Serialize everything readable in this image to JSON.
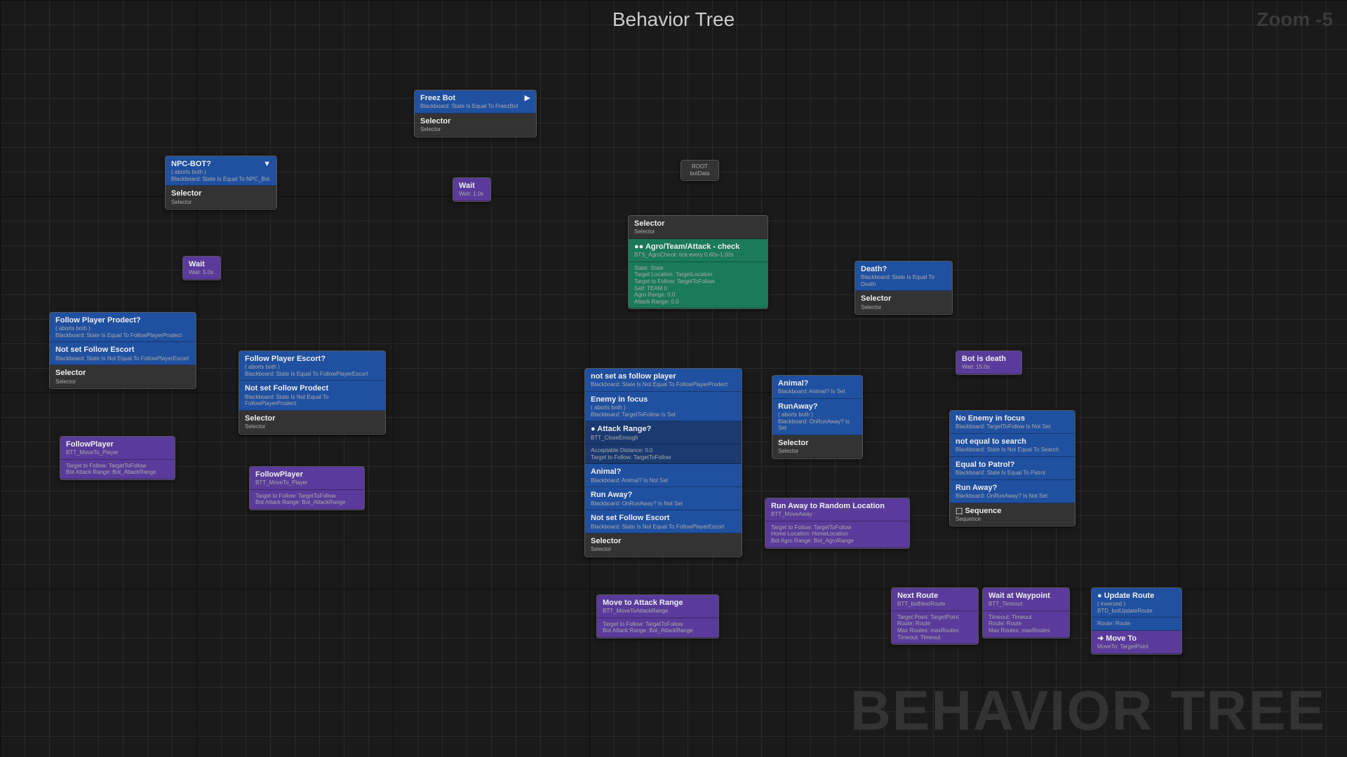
{
  "header": {
    "title": "Behavior Tree",
    "zoom": "Zoom -5",
    "watermark": "BEHAVIOR TREE"
  },
  "root": {
    "label": "ROOT",
    "sub": "botData"
  },
  "freez": {
    "title": "Freez Bot",
    "cond": "Blackboard: State Is Equal To FreezBot",
    "sel": "Selector",
    "selSub": "Selector"
  },
  "npc": {
    "title": "NPC-BOT?",
    "abort": "( aborts both )",
    "cond": "Blackboard: State Is Equal To NPC_Bot",
    "sel": "Selector",
    "selSub": "Selector"
  },
  "wait1": {
    "title": "Wait",
    "sub": "Wait: 1.0s"
  },
  "wait2": {
    "title": "Wait",
    "sub": "Wait: 5.0s"
  },
  "followProdect": {
    "title": "Follow Player Prodect?",
    "abort": "( aborts both )",
    "cond1": "Blackboard: State Is Equal To FollowPlayerProdect",
    "title2": "Not set Follow Escort",
    "cond2": "Blackboard: State Is Not Equal To FollowPlayerEscort",
    "sel": "Selector",
    "selSub": "Selector"
  },
  "followEscort": {
    "title": "Follow Player Escort?",
    "abort": "( aborts both )",
    "cond1": "Blackboard: State Is Equal To FollowPlayerEscort",
    "title2": "Not set Follow Prodect",
    "cond2": "Blackboard: State Is Not Equal To FollowPlayerProdect",
    "sel": "Selector",
    "selSub": "Selector"
  },
  "fp1": {
    "title": "FollowPlayer",
    "svc": "BTT_MoveTo_Player",
    "l1": "Target to Follow: TargetToFollow",
    "l2": "Bot Attack Range: Bot_AttackRange"
  },
  "fp2": {
    "title": "FollowPlayer",
    "svc": "BTT_MoveTo_Player",
    "l1": "Target to Follow: TargetToFollow",
    "l2": "Bot Attack Range: Bot_AttackRange"
  },
  "mainSel": {
    "sel": "Selector",
    "selSub": "Selector",
    "svc": "Agro/Team/Attack - check",
    "svcSub": "BTS_AgroCheck: tick every 0.60s-1.00s",
    "p1": "State: State",
    "p2": "Target Location: TargetLocation",
    "p3": "Target to Follow: TargetToFollow",
    "p4": "Self: TEAM 0",
    "p5": "Agro Range: 0.0",
    "p6": "Attack Range: 0.0"
  },
  "death": {
    "title": "Death?",
    "cond": "Blackboard: State Is Equal To Death",
    "sel": "Selector",
    "selSub": "Selector"
  },
  "botDeath": {
    "title": "Bot is death",
    "sub": "Wait: 15.0s"
  },
  "combat": {
    "t1": "not set as follow player",
    "c1": "Blackboard: State Is Not Equal To FollowPlayerProdect",
    "t2": "Enemy in focus",
    "ab2": "( aborts both )",
    "c2": "Blackboard: TargetToFollow Is Set",
    "t3": "Attack Range?",
    "c3": "BTT_CloseEnough",
    "c3a": "Acceptable Distance: 0.0",
    "c3b": "Target to Follow: TargetToFollow",
    "t4": "Animal?",
    "c4": "Blackboard: Animal? Is Not Set",
    "t5": "Run Away?",
    "c5": "Blackboard: OnRunAway? Is Not Set",
    "t6": "Not set Follow Escort",
    "c6": "Blackboard: State Is Not Equal To FollowPlayerEscort",
    "sel": "Selector",
    "selSub": "Selector"
  },
  "animal": {
    "t1": "Animal?",
    "c1": "Blackboard: Animal? Is Set",
    "t2": "RunAway?",
    "ab": "( aborts both )",
    "c2": "Blackboard: OnRunAway? Is Set",
    "sel": "Selector",
    "selSub": "Selector"
  },
  "runaway": {
    "title": "Run Away to Random Location",
    "svc": "BTT_MoveAway",
    "l1": "Target to Follow: TargetToFollow",
    "l2": "Home Location: HomeLocation",
    "l3": "Bot Agro Range: Bot_AgroRange"
  },
  "moveAtk": {
    "title": "Move to Attack Range",
    "svc": "BTT_MoveToAttackRange",
    "l1": "Target to Follow: TargetToFollow",
    "l2": "Bot Attack Range: Bot_AttackRange"
  },
  "patrol": {
    "t1": "No Enemy in focus",
    "c1": "Blackboard: TargetToFollow Is Not Set",
    "t2": "not equal to search",
    "c2": "Blackboard: State Is Not Equal To Search",
    "t3": "Equal to Patrol?",
    "c3": "Blackboard: State Is Equal To Patrol",
    "t4": "Run Away?",
    "c4": "Blackboard: OnRunAway? Is Not Set",
    "seq": "Sequence",
    "seqSub": "Sequence"
  },
  "nextRoute": {
    "title": "Next Route",
    "svc": "BTT_botNextRoute",
    "l1": "Target Point: TargetPoint",
    "l2": "Route: Route",
    "l3": "Max Routes: maxRoutes",
    "l4": "Timeout: Timeout"
  },
  "waitWp": {
    "title": "Wait at Waypoint",
    "svc": "BTT_Timeout",
    "l1": "Timeout: Timeout",
    "l2": "Route: Route",
    "l3": "Max Routes: maxRoutes"
  },
  "updRoute": {
    "title": "Update Route",
    "ab": "( inversed )",
    "svc": "BTD_botUpdateRoute",
    "l1": "Route: Route",
    "t2": "Move To",
    "c2": "MoveTo: TargetPoint"
  }
}
